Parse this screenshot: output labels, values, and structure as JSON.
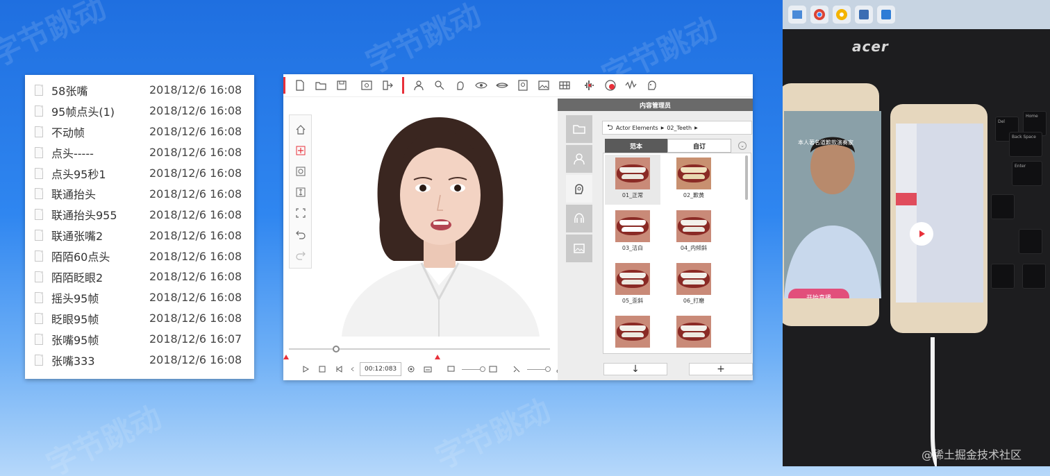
{
  "watermark_text": "字节跳动",
  "file_list": {
    "files": [
      {
        "name": "58张嘴",
        "date": "2018/12/6 16:08"
      },
      {
        "name": "95帧点头(1)",
        "date": "2018/12/6 16:08"
      },
      {
        "name": "不动帧",
        "date": "2018/12/6 16:08"
      },
      {
        "name": "点头-----",
        "date": "2018/12/6 16:08"
      },
      {
        "name": "点头95秒1",
        "date": "2018/12/6 16:08"
      },
      {
        "name": "联通抬头",
        "date": "2018/12/6 16:08"
      },
      {
        "name": "联通抬头955",
        "date": "2018/12/6 16:08"
      },
      {
        "name": "联通张嘴2",
        "date": "2018/12/6 16:08"
      },
      {
        "name": "陌陌60点头",
        "date": "2018/12/6 16:08"
      },
      {
        "name": "陌陌眨眼2",
        "date": "2018/12/6 16:08"
      },
      {
        "name": "摇头95帧",
        "date": "2018/12/6 16:08"
      },
      {
        "name": "眨眼95帧",
        "date": "2018/12/6 16:08"
      },
      {
        "name": "张嘴95帧",
        "date": "2018/12/6 16:07"
      },
      {
        "name": "张嘴333",
        "date": "2018/12/6 16:08"
      }
    ]
  },
  "editor": {
    "timecode": "00:12:083",
    "timeline_progress": 0.18,
    "toolbar_icons": [
      "new-file-icon",
      "open-folder-icon",
      "save-icon",
      "preview-icon",
      "export-icon",
      "actor-icon",
      "edit-icon",
      "head-icon",
      "eye-icon",
      "mouth-icon",
      "portrait-icon",
      "image-icon",
      "grid-icon",
      "audio-icon",
      "record-icon",
      "wave-icon",
      "face-icon"
    ],
    "left_tools": [
      "home-icon",
      "move-icon",
      "rotate-icon",
      "height-icon",
      "fit-icon",
      "undo-icon",
      "redo-icon"
    ],
    "content_manager": {
      "title": "内容管理员",
      "path_root": "Actor Elements",
      "path_folder": "02_Teeth",
      "tab_sample": "范本",
      "tab_custom": "自订",
      "download_label": "↓",
      "add_label": "+",
      "items": [
        {
          "label": "01_正常",
          "selected": true
        },
        {
          "label": "02_歉黄",
          "selected": false
        },
        {
          "label": "03_洁白",
          "selected": false
        },
        {
          "label": "04_内倾斜",
          "selected": false
        },
        {
          "label": "05_歪斜",
          "selected": false
        },
        {
          "label": "06_打磨",
          "selected": false
        },
        {
          "label": "",
          "selected": false
        },
        {
          "label": "",
          "selected": false
        }
      ]
    }
  },
  "photo": {
    "laptop_brand": "acer",
    "live_button": "开始直播",
    "phone_banner": "本人著名道歉款演奏家",
    "keys": [
      "Del",
      "Home",
      "Back Space",
      "Enter"
    ],
    "watermark": "@稀土掘金技术社区"
  }
}
